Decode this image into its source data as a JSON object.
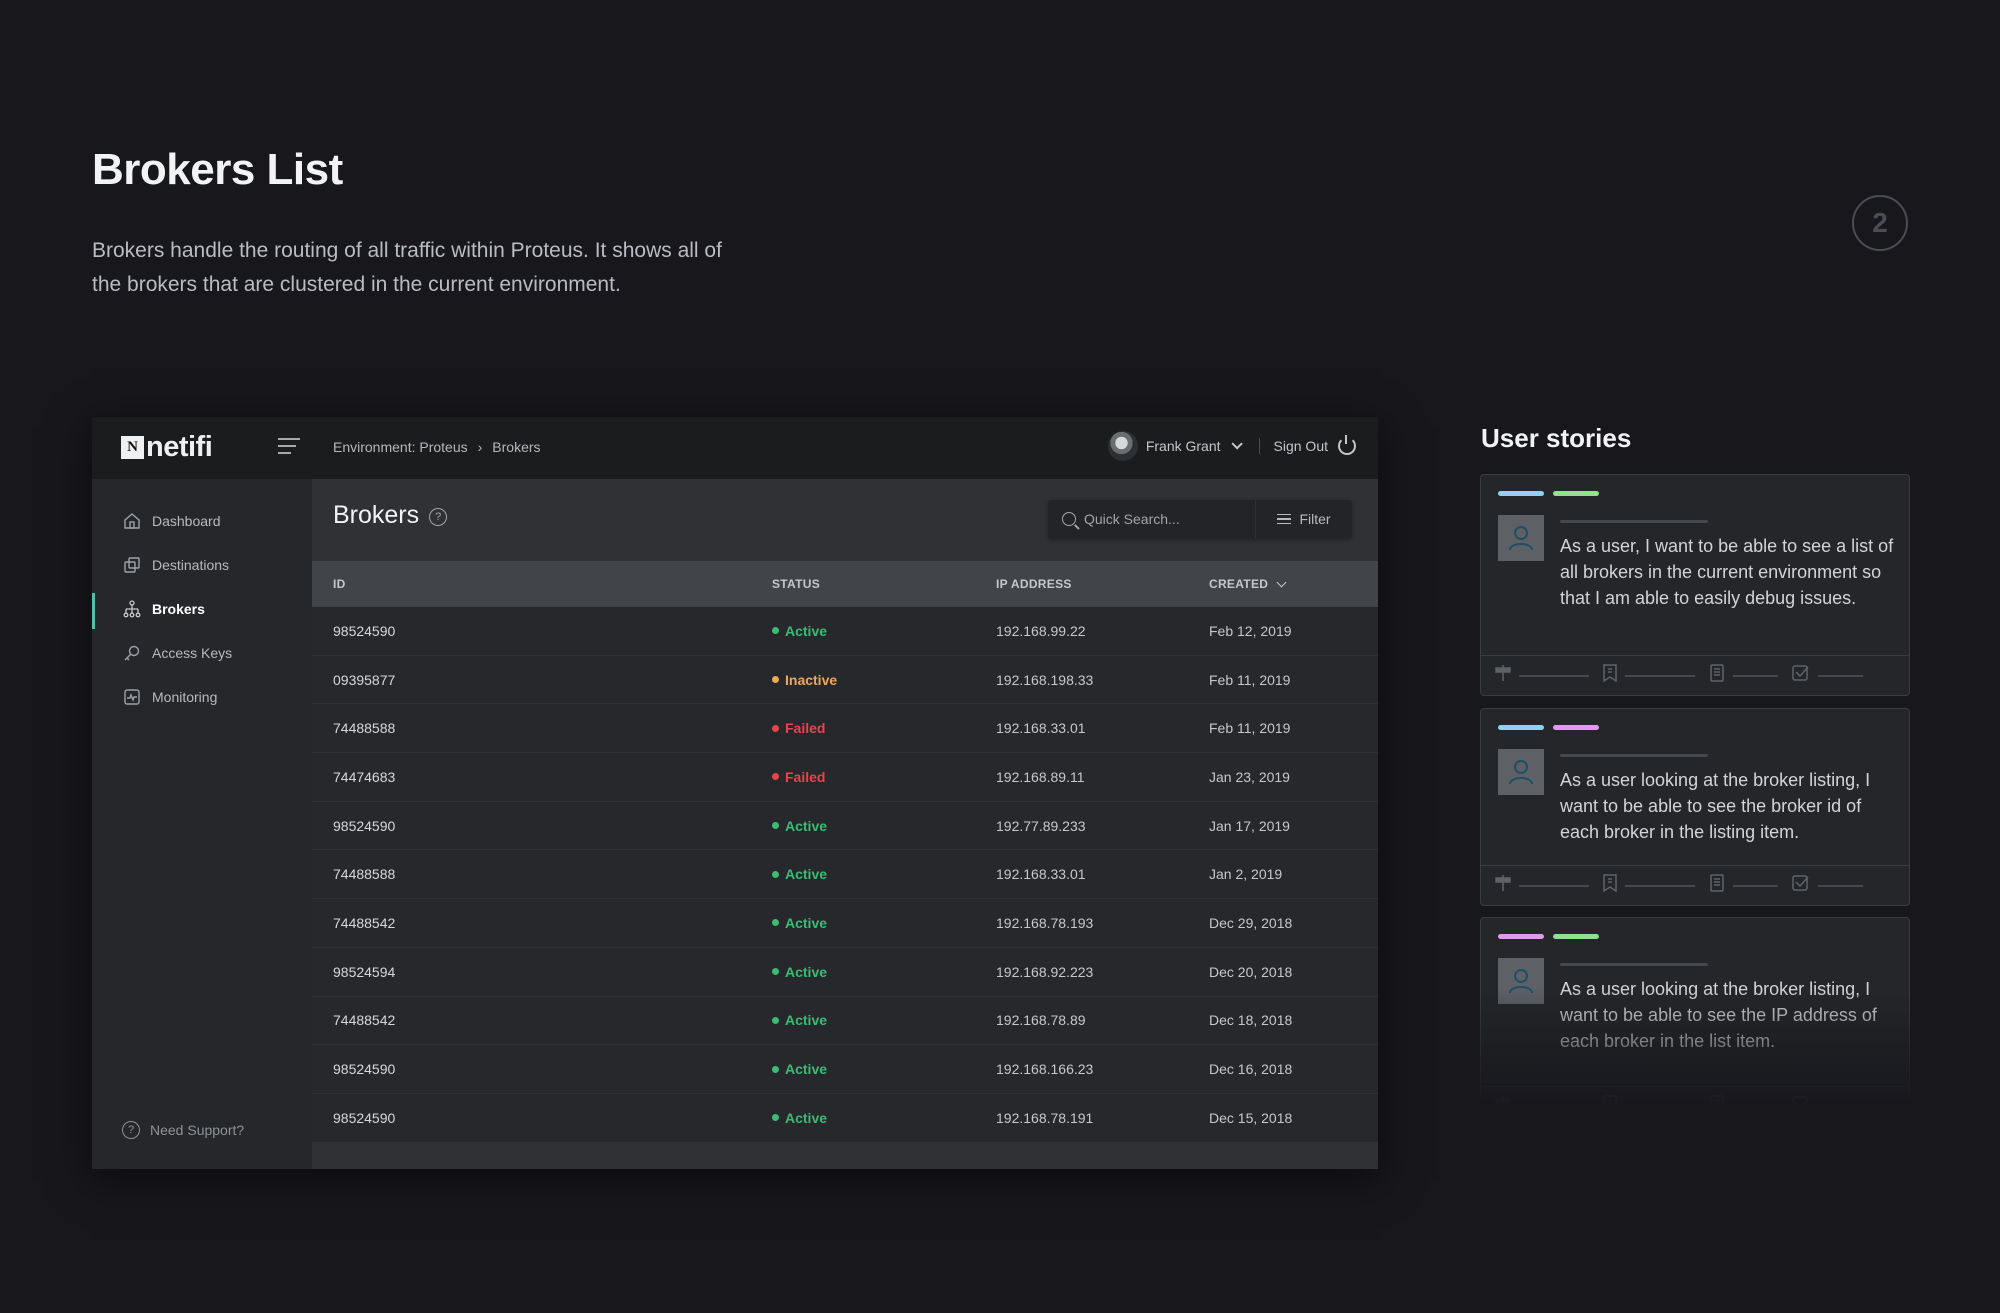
{
  "header": {
    "title": "Brokers List",
    "description": "Brokers handle the routing of all traffic within Proteus. It shows all of the brokers that are clustered in the current environment.",
    "step_number": "2"
  },
  "app": {
    "logo": {
      "mark": "N",
      "text": "netifi"
    },
    "breadcrumb": [
      "Environment: Proteus",
      "Brokers"
    ],
    "user": {
      "name": "Frank Grant",
      "sign_out_label": "Sign Out"
    },
    "sidebar": {
      "items": [
        {
          "label": "Dashboard",
          "icon": "home-icon",
          "active": false
        },
        {
          "label": "Destinations",
          "icon": "destinations-icon",
          "active": false
        },
        {
          "label": "Brokers",
          "icon": "hierarchy-icon",
          "active": true
        },
        {
          "label": "Access Keys",
          "icon": "key-icon",
          "active": false
        },
        {
          "label": "Monitoring",
          "icon": "monitoring-icon",
          "active": false
        }
      ],
      "support_label": "Need Support?"
    },
    "main": {
      "title": "Brokers",
      "search_placeholder": "Quick Search...",
      "filter_label": "Filter",
      "columns": [
        "ID",
        "STATUS",
        "IP ADDRESS",
        "CREATED"
      ],
      "sorted_column": "CREATED",
      "status_colors": {
        "Active": "#3dba74",
        "Inactive": "#f2a65a",
        "Failed": "#e8444f"
      },
      "rows": [
        {
          "id": "98524590",
          "status": "Active",
          "ip": "192.168.99.22",
          "created": "Feb 12, 2019"
        },
        {
          "id": "09395877",
          "status": "Inactive",
          "ip": "192.168.198.33",
          "created": "Feb 11, 2019"
        },
        {
          "id": "74488588",
          "status": "Failed",
          "ip": "192.168.33.01",
          "created": "Feb 11, 2019"
        },
        {
          "id": "74474683",
          "status": "Failed",
          "ip": "192.168.89.11",
          "created": "Jan 23, 2019"
        },
        {
          "id": "98524590",
          "status": "Active",
          "ip": "192.77.89.233",
          "created": "Jan 17, 2019"
        },
        {
          "id": "74488588",
          "status": "Active",
          "ip": "192.168.33.01",
          "created": "Jan 2, 2019"
        },
        {
          "id": "74488542",
          "status": "Active",
          "ip": "192.168.78.193",
          "created": "Dec 29, 2018"
        },
        {
          "id": "98524594",
          "status": "Active",
          "ip": "192.168.92.223",
          "created": "Dec 20, 2018"
        },
        {
          "id": "74488542",
          "status": "Active",
          "ip": "192.168.78.89",
          "created": "Dec 18, 2018"
        },
        {
          "id": "98524590",
          "status": "Active",
          "ip": "192.168.166.23",
          "created": "Dec 16, 2018"
        },
        {
          "id": "98524590",
          "status": "Active",
          "ip": "192.168.78.191",
          "created": "Dec 15, 2018"
        }
      ]
    }
  },
  "user_stories": {
    "title": "User stories",
    "tag_colors": {
      "blue": "#8fd0f4",
      "green": "#8fe38c",
      "pink": "#e29af0"
    },
    "items": [
      {
        "tags": [
          "blue",
          "green"
        ],
        "text": "As a user, I want to be able to see a list of all brokers in the current environment so that I am able to easily debug issues."
      },
      {
        "tags": [
          "blue",
          "pink"
        ],
        "text": "As a user looking at the broker listing, I want to be able to see the broker id of each broker in the listing item."
      },
      {
        "tags": [
          "pink",
          "green"
        ],
        "text": "As a user looking at the broker listing, I want to be able to see the IP address of each broker in the list item."
      }
    ],
    "footer_icons": [
      "signpost-icon",
      "bookmark-icon",
      "document-icon",
      "checkbox-icon"
    ]
  }
}
